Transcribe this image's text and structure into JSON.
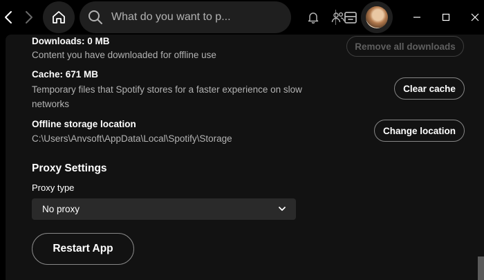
{
  "topbar": {
    "search_placeholder": "What do you want to p...",
    "icons": [
      "back-icon",
      "forward-icon",
      "home-icon",
      "search-icon",
      "browse-icon",
      "bell-icon",
      "friends-icon",
      "avatar",
      "minimize-icon",
      "maximize-icon",
      "close-icon"
    ]
  },
  "storage": {
    "downloads_title": "Downloads: 0 MB",
    "downloads_desc": "Content you have downloaded for offline use",
    "remove_all_label": "Remove all downloads",
    "cache_title": "Cache: 671 MB",
    "cache_desc_line1": "Temporary files that Spotify stores for a faster experience on slow",
    "cache_desc_line2": "networks",
    "clear_cache_label": "Clear cache",
    "offline_title": "Offline storage location",
    "offline_path": "C:\\Users\\Anvsoft\\AppData\\Local\\Spotify\\Storage",
    "change_location_label": "Change location"
  },
  "proxy": {
    "section_title": "Proxy Settings",
    "type_label": "Proxy type",
    "type_value": "No proxy"
  },
  "restart_label": "Restart App",
  "colors": {
    "background": "#000000",
    "panel": "#121212",
    "field": "#2a2a2a",
    "muted_text": "#b3b3b3"
  }
}
